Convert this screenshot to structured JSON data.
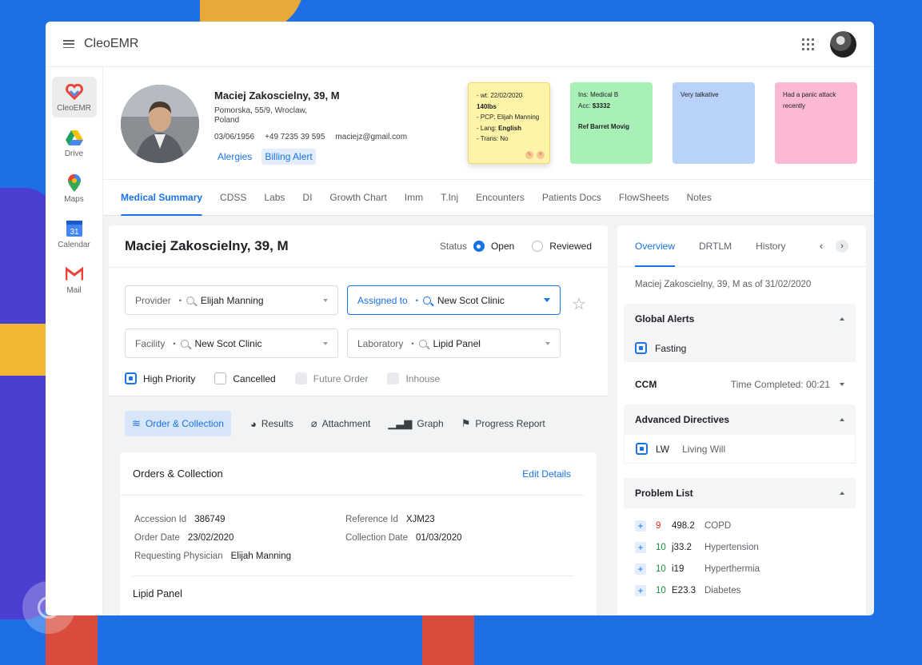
{
  "app": {
    "title": "CleoEMR"
  },
  "rail": {
    "items": [
      {
        "label": "CleoEMR",
        "icon": "heart-logo-icon"
      },
      {
        "label": "Drive",
        "icon": "drive-icon"
      },
      {
        "label": "Maps",
        "icon": "map-pin-icon"
      },
      {
        "label": "Calendar",
        "icon": "calendar-icon",
        "day": "31"
      },
      {
        "label": "Mail",
        "icon": "mail-icon"
      }
    ]
  },
  "patient": {
    "name": "Maciej Zakoscielny, 39, M",
    "address": "Pomorska, 55/9, Wroclaw, Poland",
    "dob": "03/06/1956",
    "phone": "+49 7235 39 595",
    "email": "maciejz@gmail.com",
    "tags": [
      "Alergies",
      "Billing Alert"
    ]
  },
  "notes": {
    "yellow": {
      "line1": "- wt: 22/02/2020",
      "line2": "140lbs",
      "line3": "- PCP: Elijah Manning",
      "line4_label": "- Lang: ",
      "line4_value": "English",
      "line5": "- Trans: No"
    },
    "green": {
      "line1": "Ins: Medical B",
      "line2_label": "Acc: ",
      "line2_value": "$3332",
      "line3": "Ref Barret Movig"
    },
    "blue": {
      "text": "Very talkative"
    },
    "pink": {
      "text": "Had a panic attack recently"
    }
  },
  "tabs": [
    "Medical Summary",
    "CDSS",
    "Labs",
    "DI",
    "Growth Chart",
    "Imm",
    "T.Inj",
    "Encounters",
    "Patients Docs",
    "FlowSheets",
    "Notes"
  ],
  "order": {
    "title": "Maciej Zakoscielny, 39, M",
    "status_label": "Status",
    "status_open": "Open",
    "status_reviewed": "Reviewed",
    "provider": {
      "label": "Provider",
      "value": "Elijah Manning"
    },
    "assigned": {
      "label": "Assigned to",
      "value": "New Scot Clinic"
    },
    "facility": {
      "label": "Facility",
      "value": "New Scot Clinic"
    },
    "laboratory": {
      "label": "Laboratory",
      "value": "Lipid Panel"
    },
    "checks": {
      "high_priority": "High Priority",
      "cancelled": "Cancelled",
      "future_order": "Future Order",
      "inhouse": "Inhouse"
    },
    "subtabs": [
      "Order & Collection",
      "Results",
      "Attachment",
      "Graph",
      "Progress Report"
    ]
  },
  "collection": {
    "title": "Orders & Collection",
    "edit": "Edit Details",
    "accession_label": "Accession Id",
    "accession_value": "386749",
    "reference_label": "Reference Id",
    "reference_value": "XJM23",
    "order_date_label": "Order Date",
    "order_date_value": "23/02/2020",
    "collection_date_label": "Collection Date",
    "collection_date_value": "01/03/2020",
    "physician_label": "Requesting Physician",
    "physician_value": "Elijah Manning",
    "panel": "Lipid Panel"
  },
  "side": {
    "tabs": [
      "Overview",
      "DRTLM",
      "History"
    ],
    "as_of": "Maciej Zakoscielny, 39, M as of 31/02/2020",
    "global_alerts": {
      "title": "Global Alerts",
      "item": "Fasting"
    },
    "ccm": {
      "label": "CCM",
      "time": "Time Completed: 00:21"
    },
    "advanced": {
      "title": "Advanced Directives",
      "code": "LW",
      "text": "Living Will"
    },
    "problems": {
      "title": "Problem List",
      "items": [
        {
          "num": "9",
          "code": "498.2",
          "name": "COPD",
          "color": "#d93025"
        },
        {
          "num": "10",
          "code": "j33.2",
          "name": "Hypertension",
          "color": "#1e8e3e"
        },
        {
          "num": "10",
          "code": "i19",
          "name": "Hyperthermia",
          "color": "#1e8e3e"
        },
        {
          "num": "10",
          "code": "E23.3",
          "name": "Diabetes",
          "color": "#1e8e3e"
        }
      ]
    }
  },
  "colors": {
    "accent": "#1a73e8",
    "background": "#1e6fe6"
  }
}
